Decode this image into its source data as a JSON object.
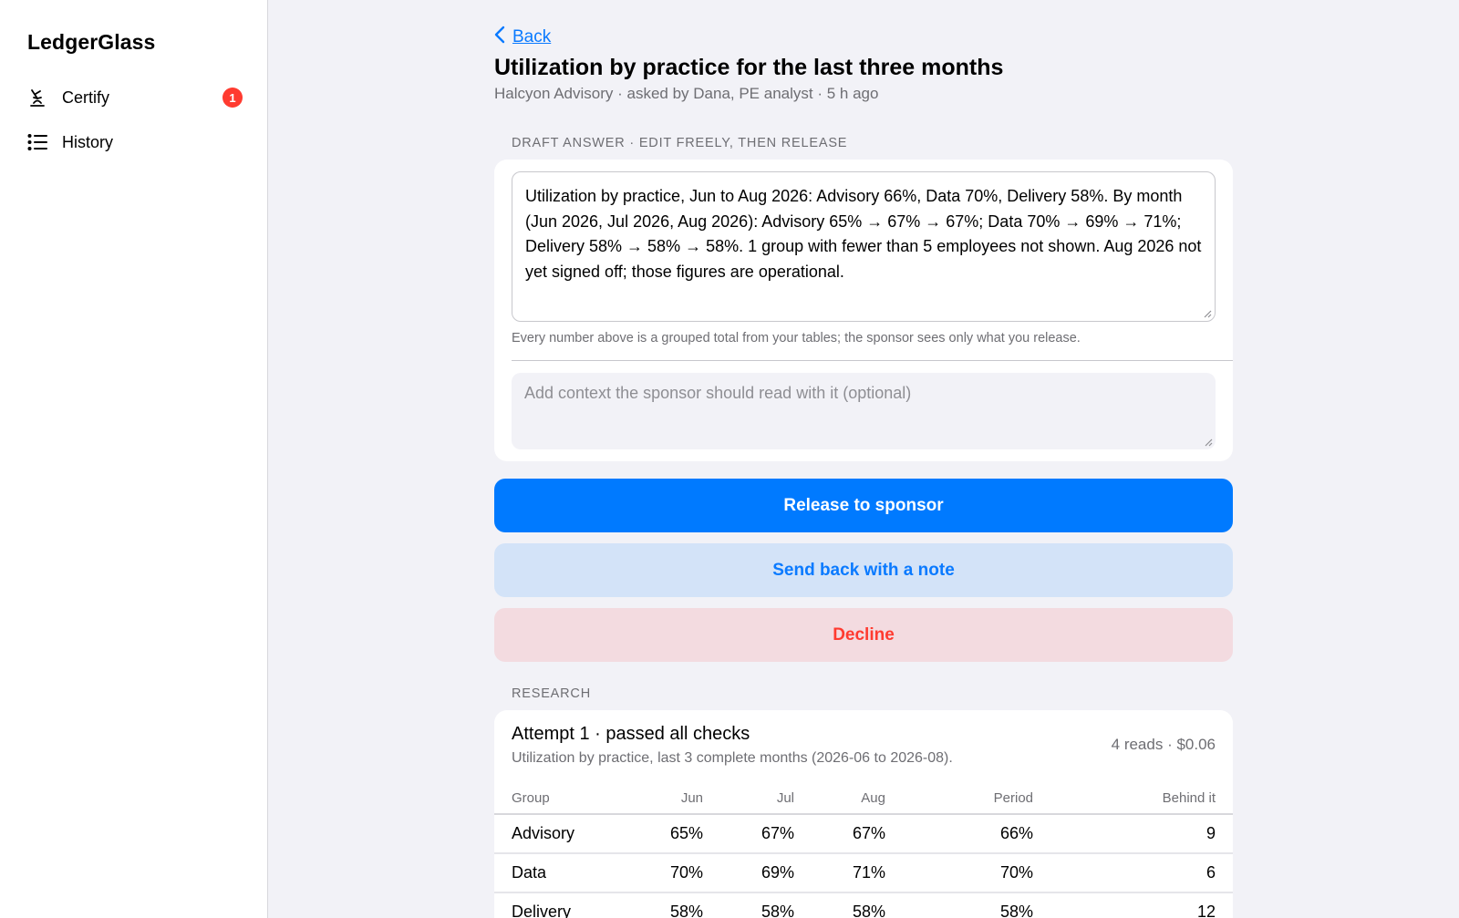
{
  "app": {
    "name": "LedgerGlass"
  },
  "sidebar": {
    "items": [
      {
        "label": "Certify",
        "icon": "certify-icon",
        "badge": "1"
      },
      {
        "label": "History",
        "icon": "list-icon"
      }
    ]
  },
  "header": {
    "back_label": "Back",
    "title": "Utilization by practice for the last three months",
    "subtitle": "Halcyon Advisory · asked by Dana, PE analyst · 5 h ago"
  },
  "draft": {
    "section_label": "DRAFT ANSWER · EDIT FREELY, THEN RELEASE",
    "text": "Utilization by practice, Jun to Aug 2026: Advisory 66%, Data 70%, Delivery 58%. By month (Jun 2026, Jul 2026, Aug 2026): Advisory 65% → 67% → 67%; Data 70% → 69% → 71%; Delivery 58% → 58% → 58%. 1 group with fewer than 5 employees not shown. Aug 2026 not yet signed off; those figures are operational.",
    "helper": "Every number above is a grouped total from your tables; the sponsor sees only what you release.",
    "context_placeholder": "Add context the sponsor should read with it (optional)"
  },
  "actions": {
    "release": "Release to sponsor",
    "send_back": "Send back with a note",
    "decline": "Decline"
  },
  "research": {
    "section_label": "RESEARCH",
    "attempt_title": "Attempt 1 · passed all checks",
    "attempt_desc": "Utilization by practice, last 3 complete months (2026-06 to 2026-08).",
    "meta": "4 reads · $0.06",
    "columns": [
      "Group",
      "Jun",
      "Jul",
      "Aug",
      "Period",
      "Behind it"
    ],
    "rows": [
      [
        "Advisory",
        "65%",
        "67%",
        "67%",
        "66%",
        "9"
      ],
      [
        "Data",
        "70%",
        "69%",
        "71%",
        "70%",
        "6"
      ],
      [
        "Delivery",
        "58%",
        "58%",
        "58%",
        "58%",
        "12"
      ]
    ]
  },
  "colors": {
    "accent": "#007aff",
    "danger": "#ff3b30",
    "background": "#f2f2f7"
  }
}
